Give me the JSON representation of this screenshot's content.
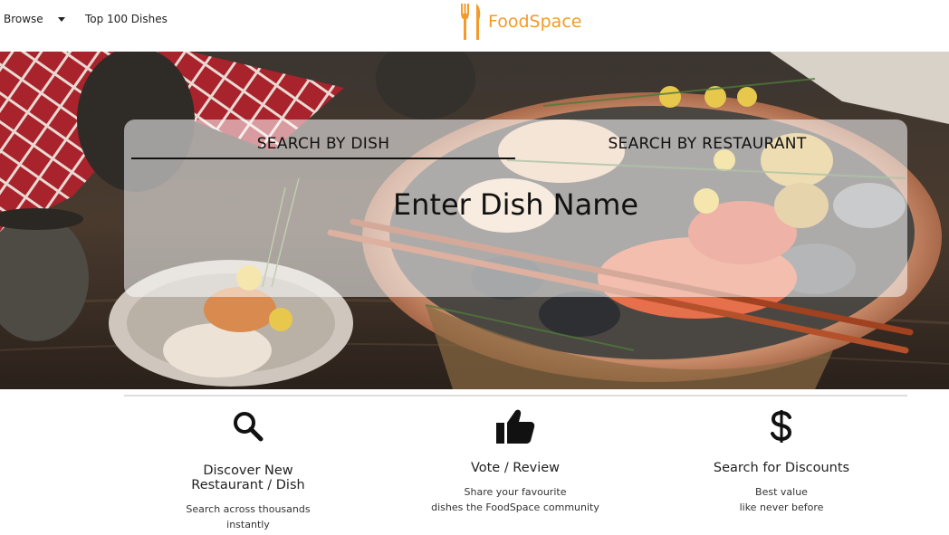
{
  "header": {
    "browse_label": "Browse",
    "top100_label": "Top 100 Dishes",
    "logo_text": "FoodSpace",
    "brand_color": "#f39a2b"
  },
  "search": {
    "tab_dish": "SEARCH BY DISH",
    "tab_restaurant": "SEARCH BY RESTAURANT",
    "active_tab": "SEARCH BY DISH",
    "placeholder": "Enter Dish Name",
    "value": ""
  },
  "features": [
    {
      "icon": "search-icon",
      "title_line1": "Discover New",
      "title_line2": "Restaurant / Dish",
      "desc_line1": "Search across thousands",
      "desc_line2": "instantly"
    },
    {
      "icon": "thumbs-up-icon",
      "title_line1": "Vote / Review",
      "desc_line1": "Share your favourite",
      "desc_line2": "dishes the FoodSpace community"
    },
    {
      "icon": "dollar-icon",
      "title_line1": "Search for Discounts",
      "desc_line1": "Best value",
      "desc_line2": "like never before"
    }
  ]
}
